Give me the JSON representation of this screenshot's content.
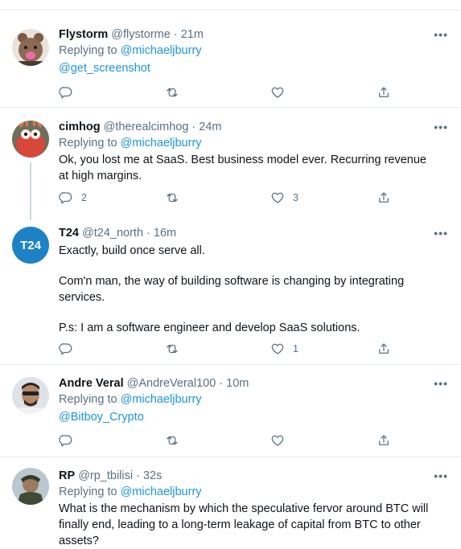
{
  "tweets": [
    {
      "name": "Flystorm",
      "handle": "@flystorme",
      "time": "21m",
      "replying_prefix": "Replying to",
      "replying_to": "@michaeljburry",
      "lines": [],
      "mention_line": "@get_screenshot",
      "reply_count": "",
      "like_count": ""
    },
    {
      "name": "cimhog",
      "handle": "@therealcimhog",
      "time": "24m",
      "replying_prefix": "Replying to",
      "replying_to": "@michaeljburry",
      "lines": [
        "Ok, you lost me at SaaS. Best business model ever. Recurring revenue at high margins."
      ],
      "reply_count": "2",
      "like_count": "3"
    },
    {
      "name": "T24",
      "handle": "@t24_north",
      "time": "16m",
      "avatar_text": "T24",
      "lines": [
        "Exactly, build once serve all.",
        "Com'n man, the way of building software is changing by integrating services.",
        "P.s: I am a software engineer and develop SaaS solutions."
      ],
      "reply_count": "",
      "like_count": "1"
    },
    {
      "name": "Andre Veral",
      "handle": "@AndreVeral100",
      "time": "10m",
      "replying_prefix": "Replying to",
      "replying_to": "@michaeljburry",
      "mention_line": "@Bitboy_Crypto",
      "reply_count": "",
      "like_count": ""
    },
    {
      "name": "RP",
      "handle": "@rp_tbilisi",
      "time": "32s",
      "replying_prefix": "Replying to",
      "replying_to": "@michaeljburry",
      "lines": [
        "What is the mechanism by which the speculative fervor around BTC will finally end, leading to a long-term leakage of capital from BTC to other assets?"
      ]
    }
  ],
  "separator": " · ",
  "more_label": "•••",
  "colors": {
    "link": "#1b95e0",
    "muted": "#5b7083",
    "t24_brand": "#1d82c5"
  }
}
